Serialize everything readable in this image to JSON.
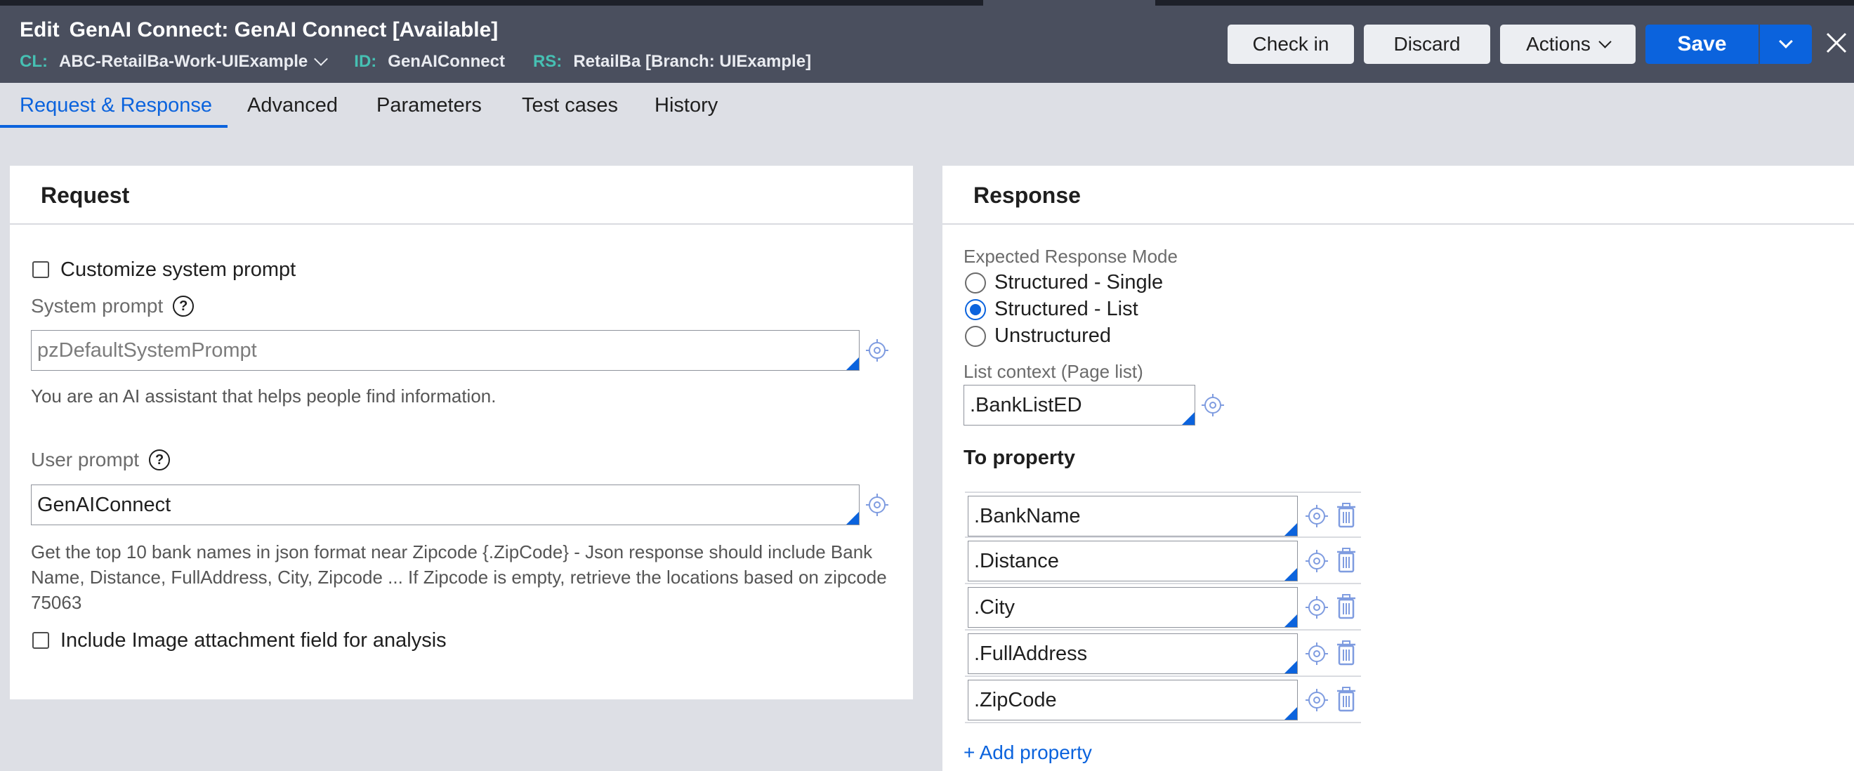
{
  "header": {
    "edit_label": "Edit",
    "title": "GenAI Connect: GenAI Connect [Available]",
    "cl_key": "CL:",
    "cl_value": "ABC-RetailBa-Work-UIExample",
    "id_key": "ID:",
    "id_value": "GenAIConnect",
    "rs_key": "RS:",
    "rs_value": "RetailBa [Branch: UIExample]",
    "buttons": {
      "check_in": "Check in",
      "discard": "Discard",
      "actions": "Actions",
      "save": "Save"
    }
  },
  "tabs": [
    {
      "label": "Request & Response",
      "active": true
    },
    {
      "label": "Advanced",
      "active": false
    },
    {
      "label": "Parameters",
      "active": false
    },
    {
      "label": "Test cases",
      "active": false
    },
    {
      "label": "History",
      "active": false
    }
  ],
  "request": {
    "title": "Request",
    "customize_system_prompt": "Customize system prompt",
    "system_prompt_label": "System prompt",
    "system_prompt_value": "pzDefaultSystemPrompt",
    "system_prompt_text": "You are an AI assistant that helps people find information.",
    "user_prompt_label": "User prompt",
    "user_prompt_value": "GenAIConnect",
    "user_prompt_text": "Get the top 10 bank names in json format near Zipcode {.ZipCode} - Json response should include Bank Name, Distance, FullAddress, City, Zipcode ... If Zipcode is empty, retrieve the locations based on zipcode 75063",
    "include_image": "Include Image attachment field for analysis"
  },
  "response": {
    "title": "Response",
    "mode_label": "Expected Response Mode",
    "modes": [
      {
        "label": "Structured - Single",
        "checked": false
      },
      {
        "label": "Structured - List",
        "checked": true
      },
      {
        "label": "Unstructured",
        "checked": false
      }
    ],
    "list_context_label": "List context (Page list)",
    "list_context_value": ".BankListED",
    "to_property_label": "To property",
    "properties": [
      ".BankName",
      ".Distance",
      ".City",
      ".FullAddress",
      ".ZipCode"
    ],
    "add_property": "+ Add property"
  },
  "colors": {
    "header_bg": "#4a4f5e",
    "accent_blue": "#0b63dd",
    "meta_key_teal": "#46c0b3",
    "page_bg": "#dddfe5"
  },
  "icons": [
    "help-icon",
    "crosshair-icon",
    "trash-icon",
    "chevron-down-icon",
    "close-icon"
  ]
}
